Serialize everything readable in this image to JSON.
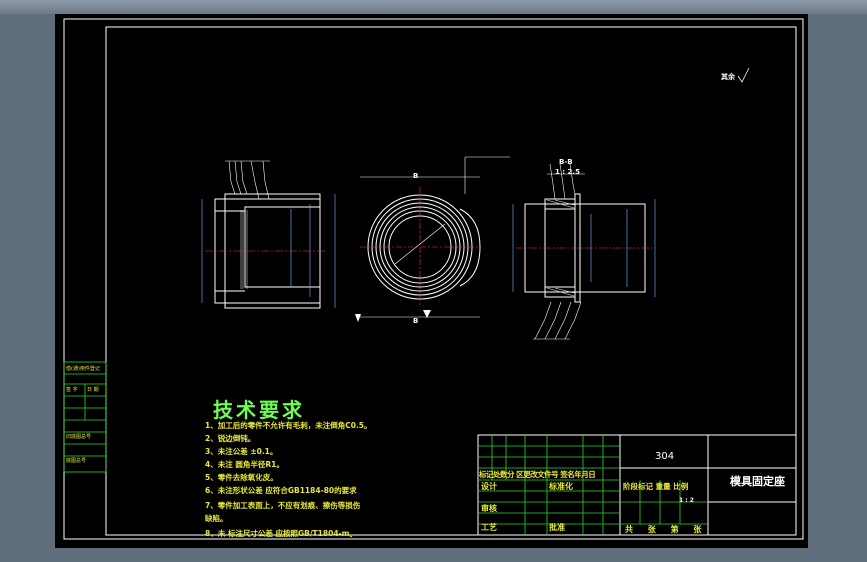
{
  "drawing": {
    "roughness_symbol": "其余",
    "section_label": "B-B",
    "section_scale": "1 : 2.5",
    "view_label": "B",
    "center_mark": "C"
  },
  "tech_requirements": {
    "title": "技术要求",
    "notes": [
      "1、加工后的零件不允许有毛刺，未注倒角C0.5。",
      "2、锐边倒钝。",
      "3、未注公差 ±0.1。",
      "4、未注 圆角半径R1。",
      "5、零件去除氧化皮。",
      "6、未注形状公差 应符合GB1184-80的要求",
      "7、零件加工表面上，不应有划痕、擦伤等损伤",
      "缺陷。",
      "8、未 标注尺寸公差 应按照GB/T1804-m。"
    ]
  },
  "title_block": {
    "material": "304",
    "part_name": "模具固定座",
    "header_row": "标记处数分 区更改文件号 签名年月日",
    "design": "设计",
    "standardize": "标准化",
    "stage_headers": "阶段标记 重量 比例",
    "review": "审核",
    "process": "工艺",
    "approve": "批准",
    "sheet_info": "共 张 第 张",
    "scale_val": "1 : 2"
  },
  "side_strip": [
    "借(通)用件登记",
    "旧底图总号",
    "底图总号",
    "签 字",
    "日 期"
  ]
}
